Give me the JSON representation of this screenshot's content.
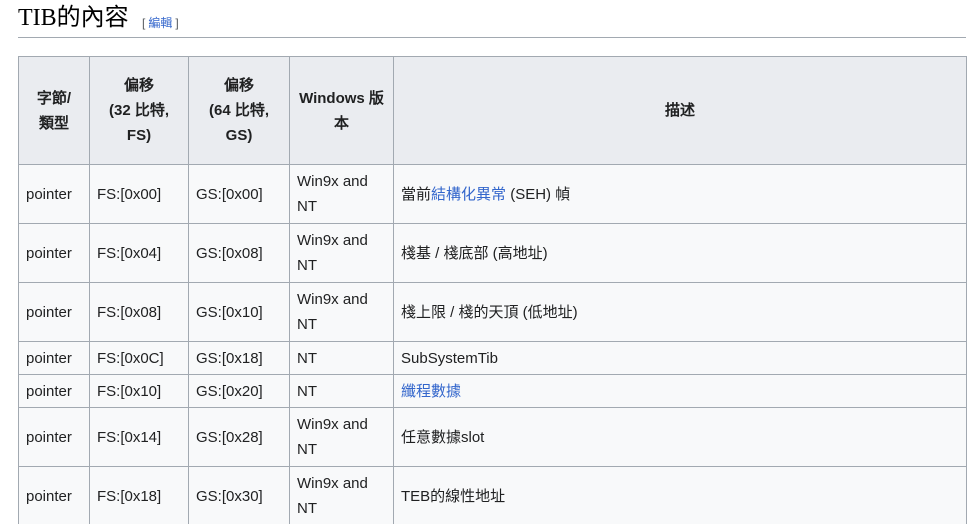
{
  "section": {
    "title": "TIB的內容",
    "edit_open": "[",
    "edit_label": "編輯",
    "edit_close": "]"
  },
  "table": {
    "headers": {
      "type_l1": "字節/",
      "type_l2": "類型",
      "off32_l1": "偏移",
      "off32_l2": "(32 比特,",
      "off32_l3": "FS)",
      "off64_l1": "偏移",
      "off64_l2": "(64 比特,",
      "off64_l3": "GS)",
      "win_l1": "Windows 版",
      "win_l2": "本",
      "desc": "描述"
    },
    "rows": [
      {
        "type": "pointer",
        "fs": "FS:[0x00]",
        "gs": "GS:[0x00]",
        "win_l1": "Win9x and",
        "win_l2": "NT",
        "desc_pre": "當前",
        "desc_link": "結構化異常",
        "desc_post": " (SEH) 幀"
      },
      {
        "type": "pointer",
        "fs": "FS:[0x04]",
        "gs": "GS:[0x08]",
        "win_l1": "Win9x and",
        "win_l2": "NT",
        "desc_pre": "棧基 / 棧底部 (高地址)",
        "desc_link": "",
        "desc_post": ""
      },
      {
        "type": "pointer",
        "fs": "FS:[0x08]",
        "gs": "GS:[0x10]",
        "win_l1": "Win9x and",
        "win_l2": "NT",
        "desc_pre": "棧上限 / 棧的天頂 (低地址)",
        "desc_link": "",
        "desc_post": ""
      },
      {
        "type": "pointer",
        "fs": "FS:[0x0C]",
        "gs": "GS:[0x18]",
        "win_l1": "NT",
        "win_l2": "",
        "desc_pre": "SubSystemTib",
        "desc_link": "",
        "desc_post": ""
      },
      {
        "type": "pointer",
        "fs": "FS:[0x10]",
        "gs": "GS:[0x20]",
        "win_l1": "NT",
        "win_l2": "",
        "desc_pre": "",
        "desc_link": "纖程數據",
        "desc_post": ""
      },
      {
        "type": "pointer",
        "fs": "FS:[0x14]",
        "gs": "GS:[0x28]",
        "win_l1": "Win9x and",
        "win_l2": "NT",
        "desc_pre": "任意數據slot",
        "desc_link": "",
        "desc_post": ""
      },
      {
        "type": "pointer",
        "fs": "FS:[0x18]",
        "gs": "GS:[0x30]",
        "win_l1": "Win9x and",
        "win_l2": "NT",
        "desc_pre": "TEB的線性地址",
        "desc_link": "",
        "desc_post": ""
      }
    ]
  }
}
